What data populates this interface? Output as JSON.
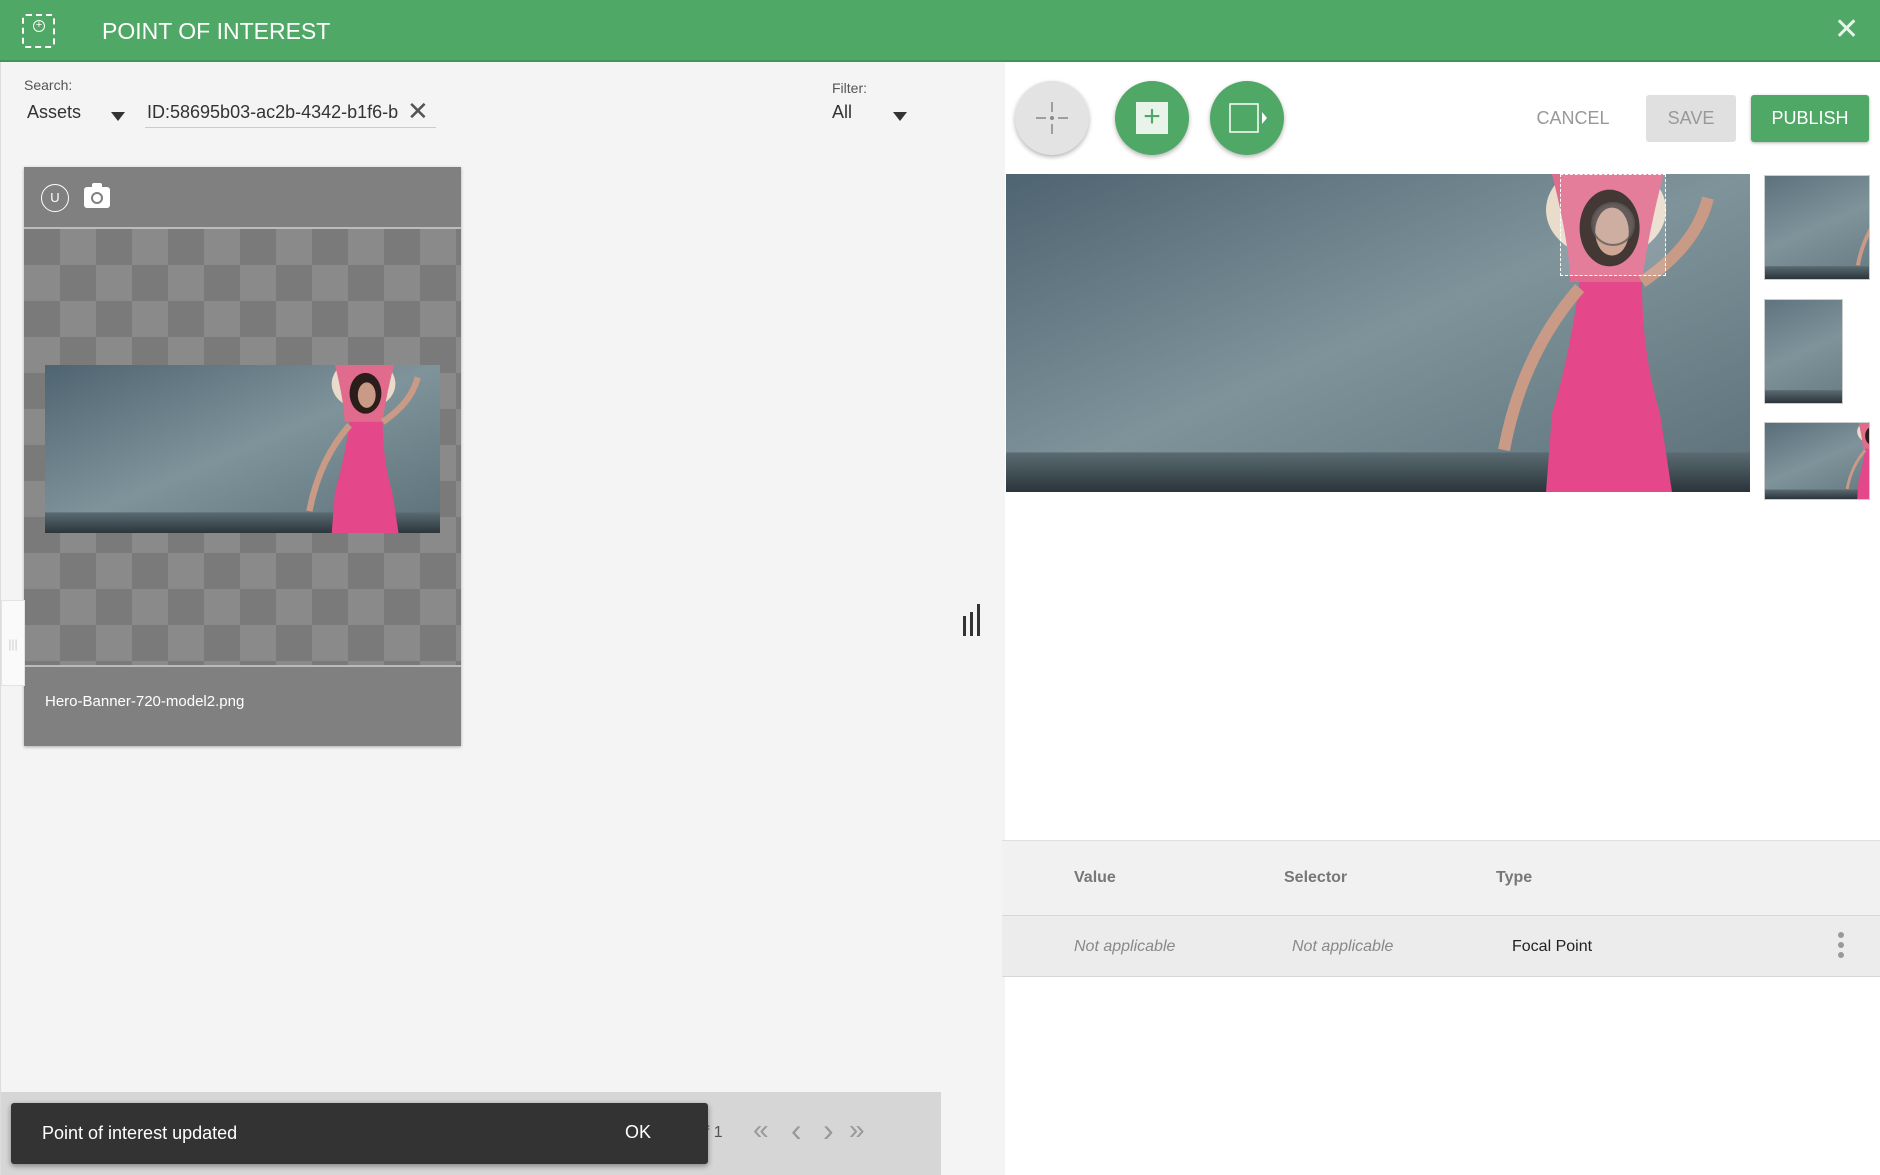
{
  "header": {
    "title": "POINT OF INTEREST",
    "logo_icon": "focal-point-icon",
    "close_icon": "close-icon",
    "color": "#4fa866"
  },
  "search": {
    "label": "Search:",
    "scope": "Assets",
    "value": "ID:58695b03-ac2b-4342-b1f6-b",
    "clear_icon": "close-icon"
  },
  "filter": {
    "label": "Filter:",
    "value": "All"
  },
  "asset_card": {
    "badge": "U",
    "camera_icon": "camera-icon",
    "filename": "Hero-Banner-720-model2.png"
  },
  "pagination": {
    "text": "of 1",
    "first": "«",
    "prev": "‹",
    "next": "›",
    "last": "»"
  },
  "snackbar": {
    "message": "Point of interest updated",
    "action": "OK"
  },
  "toolbar": {
    "focal_tool_icon": "crosshair-icon",
    "add_icon": "plus-icon",
    "crop_icon": "crop-rect-icon",
    "cancel": "CANCEL",
    "save": "SAVE",
    "publish": "PUBLISH"
  },
  "table": {
    "columns": [
      "Value",
      "Selector",
      "Type"
    ],
    "rows": [
      {
        "value": "Not applicable",
        "selector": "Not applicable",
        "type": "Focal Point"
      }
    ]
  }
}
